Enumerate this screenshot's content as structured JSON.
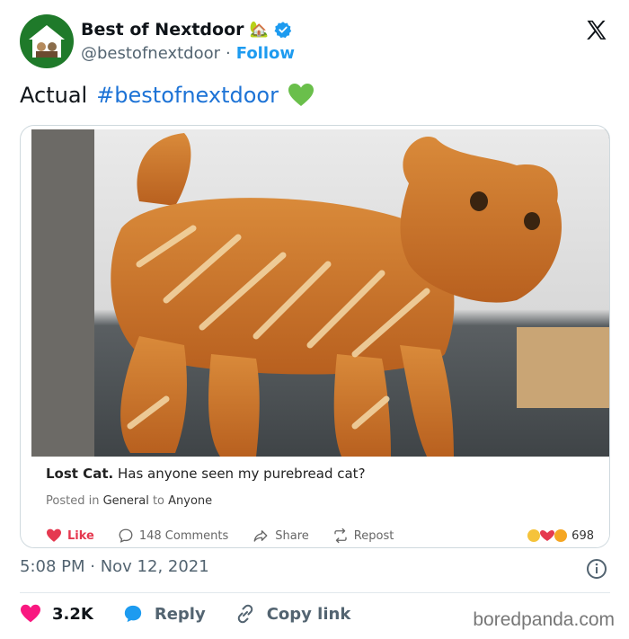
{
  "account": {
    "display_name": "Best of Nextdoor",
    "name_emoji": "🏡",
    "handle": "@bestofnextdoor",
    "separator": "·",
    "follow_label": "Follow"
  },
  "tweet": {
    "text_prefix": "Actual",
    "hashtag": "#bestofnextdoor"
  },
  "embedded_post": {
    "title_bold": "Lost Cat.",
    "title_rest": "Has anyone seen my purebread cat?",
    "posted_prefix": "Posted in",
    "category": "General",
    "to_word": "to",
    "audience": "Anyone",
    "actions": {
      "like": "Like",
      "comments": "148 Comments",
      "share": "Share",
      "repost": "Repost"
    },
    "reaction_count": "698"
  },
  "meta": {
    "timestamp": "5:08 PM · Nov 12, 2021"
  },
  "engagement": {
    "likes": "3.2K",
    "reply": "Reply",
    "copy_link": "Copy link"
  },
  "watermark": "boredpanda.com",
  "colors": {
    "accent_blue": "#1d9bf0",
    "hashtag_blue": "#1d73d6",
    "like_pink": "#f91880",
    "green_heart": "#6abf4b",
    "nextdoor_green": "#1f7a2a"
  }
}
